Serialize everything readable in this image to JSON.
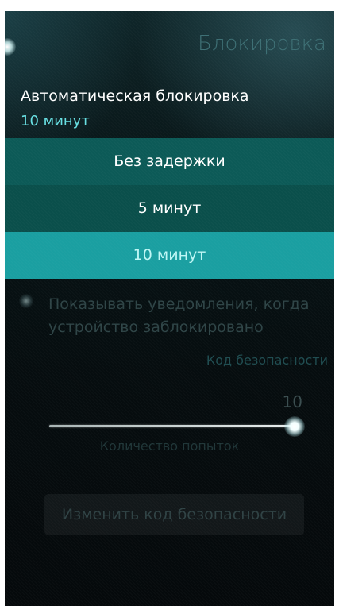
{
  "page": {
    "title": "Блокировка"
  },
  "autolock": {
    "label": "Автоматическая блокировка",
    "value": "10 минут",
    "options": [
      "Без задержки",
      "5 минут",
      "10 минут"
    ],
    "selected_index": 2
  },
  "notifications_switch": {
    "label": "Показывать уведомления, когда устройство заблокировано",
    "checked": false
  },
  "security_code": {
    "section_header": "Код безопасности",
    "attempts_slider": {
      "value_text": "10",
      "label": "Количество попыток",
      "level": 1.0
    },
    "change_button_label": "Изменить код безопасности"
  },
  "colors": {
    "accent": "#67e0e3",
    "highlight": "#1a9fa1",
    "dropdown_bg": "#0b5450"
  }
}
